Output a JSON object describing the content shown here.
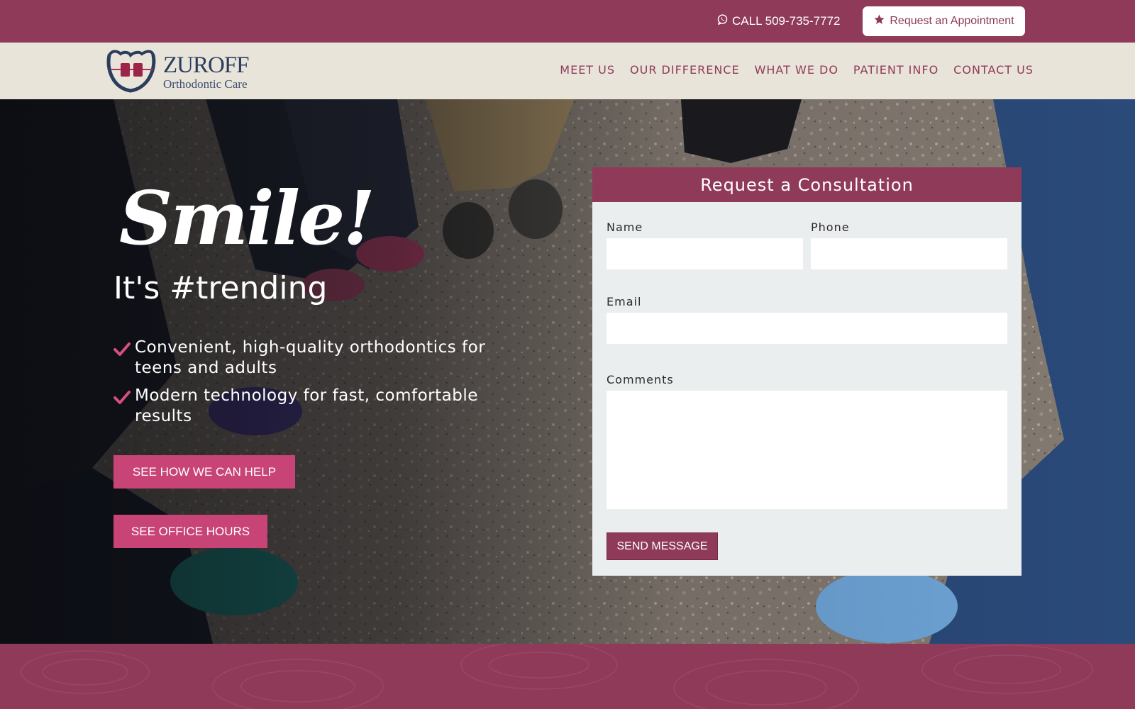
{
  "topbar": {
    "call_label": "CALL 509-735-7772",
    "appointment_label": "Request an Appointment"
  },
  "logo": {
    "name": "ZUROFF",
    "sub": "Orthodontic Care"
  },
  "nav": {
    "items": [
      "MEET US",
      "OUR DIFFERENCE",
      "WHAT WE DO",
      "PATIENT INFO",
      "CONTACT US"
    ]
  },
  "hero": {
    "headline": "Smile!",
    "subhead": "It's #trending",
    "bullets": [
      "Convenient, high-quality orthodontics for teens and adults",
      "Modern technology for fast, comfortable results"
    ],
    "buttons": {
      "help": "SEE HOW WE CAN HELP",
      "hours": "SEE OFFICE HOURS"
    }
  },
  "form": {
    "title": "Request a Consultation",
    "name_label": "Name",
    "phone_label": "Phone",
    "email_label": "Email",
    "comments_label": "Comments",
    "name_value": "",
    "phone_value": "",
    "email_value": "",
    "comments_value": "",
    "submit_label": "SEND MESSAGE"
  },
  "colors": {
    "brand_plum": "#8f3a58",
    "accent_pink": "#c84476",
    "header_beige": "#e8e4da",
    "form_gray": "#ebeeef"
  },
  "icons": {
    "call": "whatsapp-icon",
    "appointment": "star-icon",
    "bullet": "checkmark-icon"
  }
}
